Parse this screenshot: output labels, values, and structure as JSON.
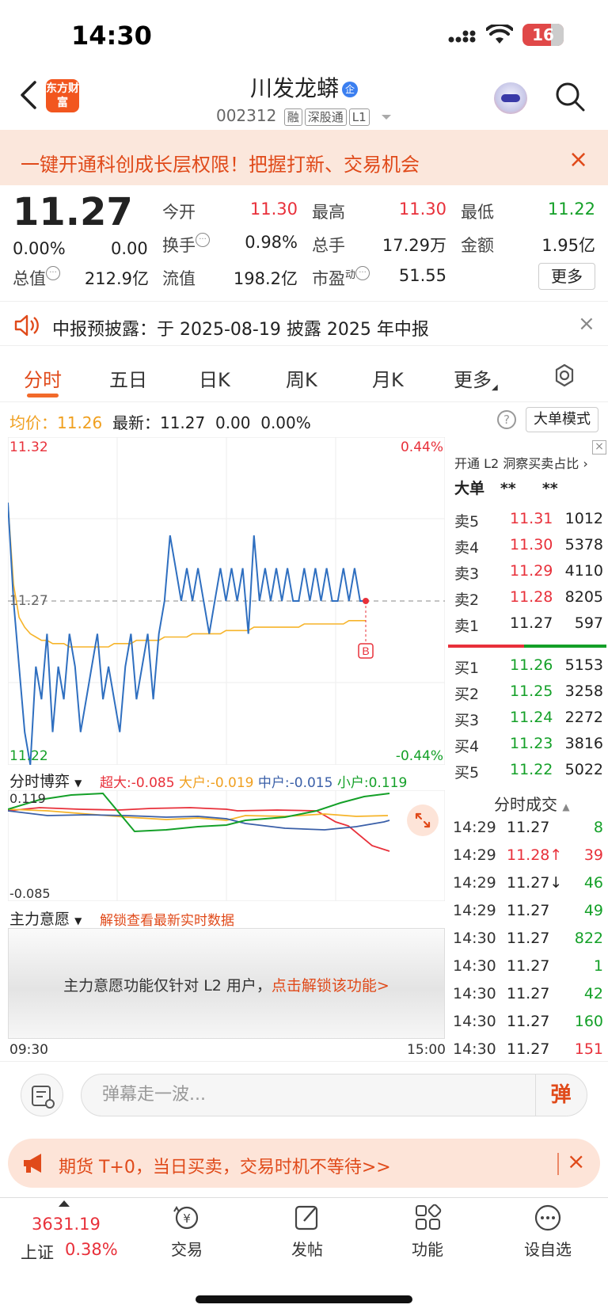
{
  "status": {
    "time": "14:30",
    "battery": "16"
  },
  "header": {
    "logo": "东方财富",
    "stock_name": "川发龙蟒",
    "badge": "企",
    "code": "002312",
    "tags": [
      "融",
      "深股通",
      "L1"
    ]
  },
  "promo": {
    "text": "一键开通科创成长层权限！把握打新、交易机会",
    "close": "×"
  },
  "quote": {
    "price": "11.27",
    "pct": "0.00%",
    "change": "0.00",
    "fields": [
      {
        "label": "今开",
        "value": "11.30"
      },
      {
        "label": "最高",
        "value": "11.30"
      },
      {
        "label": "最低",
        "value": "11.22"
      },
      {
        "label": "换手",
        "value": "0.98%"
      },
      {
        "label": "总手",
        "value": "17.29万"
      },
      {
        "label": "金额",
        "value": "1.95亿"
      },
      {
        "label": "总值",
        "value": "212.9亿"
      },
      {
        "label": "流值",
        "value": "198.2亿"
      },
      {
        "label": "市盈",
        "value": "51.55"
      }
    ],
    "pe_sup": "动",
    "more": "更多"
  },
  "notice": {
    "text": "中报预披露：于 2025-08-19 披露 2025 年中报",
    "close": "×"
  },
  "tabs": [
    "分时",
    "五日",
    "日K",
    "周K",
    "月K",
    "更多"
  ],
  "line_info": {
    "avg_label": "均价：",
    "avg_value": "11.26",
    "latest_label": "最新：",
    "latest_value": "11.27",
    "change": "0.00",
    "pct": "0.00%"
  },
  "help": "?",
  "big_order_mode": "大单模式",
  "chart_data": {
    "type": "line",
    "y_max_label": "11.32",
    "y_min_label": "11.22",
    "pct_max_label": "0.44%",
    "pct_min_label": "-0.44%",
    "ref_label": "11.27",
    "ylim": [
      11.22,
      11.32
    ],
    "prev_close": 11.27,
    "x_start": "09:30",
    "x_end": "15:00",
    "buy_marker": "B",
    "series": [
      {
        "values": [
          11.3,
          11.27,
          11.25,
          11.23,
          11.22,
          11.25,
          11.24,
          11.26,
          11.23,
          11.25,
          11.24,
          11.26,
          11.25,
          11.23,
          11.24,
          11.25,
          11.26,
          11.24,
          11.25,
          11.24,
          11.23,
          11.25,
          11.26,
          11.24,
          11.25,
          11.26,
          11.24,
          11.26,
          11.27,
          11.29,
          11.28,
          11.27,
          11.28,
          11.27,
          11.28,
          11.27,
          11.26,
          11.27,
          11.28,
          11.27,
          11.28,
          11.27,
          11.28,
          11.26,
          11.29,
          11.27,
          11.28,
          11.27,
          11.28,
          11.27,
          11.28,
          11.27,
          11.27,
          11.28,
          11.27,
          11.28,
          11.27,
          11.28,
          11.27,
          11.27,
          11.28,
          11.27,
          11.28,
          11.27,
          11.27
        ]
      },
      {
        "values": [
          11.3,
          11.275,
          11.265,
          11.262,
          11.26,
          11.259,
          11.258,
          11.258,
          11.257,
          11.257,
          11.257,
          11.256,
          11.256,
          11.256,
          11.256,
          11.256,
          11.256,
          11.256,
          11.256,
          11.257,
          11.257,
          11.257,
          11.257,
          11.258,
          11.258,
          11.258,
          11.258,
          11.258,
          11.259,
          11.259,
          11.259,
          11.259,
          11.259,
          11.26,
          11.26,
          11.26,
          11.26,
          11.26,
          11.26,
          11.261,
          11.261,
          11.261,
          11.261,
          11.261,
          11.262,
          11.262,
          11.262,
          11.262,
          11.262,
          11.262,
          11.262,
          11.262,
          11.262,
          11.263,
          11.263,
          11.263,
          11.263,
          11.263,
          11.263,
          11.263,
          11.263,
          11.264,
          11.264,
          11.264,
          11.264
        ]
      }
    ]
  },
  "order_book": {
    "header": "开通 L2 洞察买卖占比",
    "close": "×",
    "big_label": "大单",
    "big_vals": [
      "**",
      "**"
    ],
    "sells": [
      {
        "label": "卖5",
        "price": "11.31",
        "vol": "1012"
      },
      {
        "label": "卖4",
        "price": "11.30",
        "vol": "5378"
      },
      {
        "label": "卖3",
        "price": "11.29",
        "vol": "4110"
      },
      {
        "label": "卖2",
        "price": "11.28",
        "vol": "8205"
      },
      {
        "label": "卖1",
        "price": "11.27",
        "vol": "597"
      }
    ],
    "buys": [
      {
        "label": "买1",
        "price": "11.26",
        "vol": "5153"
      },
      {
        "label": "买2",
        "price": "11.25",
        "vol": "3258"
      },
      {
        "label": "买3",
        "price": "11.24",
        "vol": "2272"
      },
      {
        "label": "买4",
        "price": "11.23",
        "vol": "3816"
      },
      {
        "label": "买5",
        "price": "11.22",
        "vol": "5022"
      }
    ]
  },
  "game": {
    "label": "分时博弈",
    "legend": [
      {
        "name": "超大",
        "value": "-0.085",
        "color": "#e8303a"
      },
      {
        "name": "大户",
        "value": "-0.019",
        "color": "#f0a020"
      },
      {
        "name": "中户",
        "value": "-0.015",
        "color": "#3a5fa8"
      },
      {
        "name": "小户",
        "value": "0.119",
        "color": "#14a028"
      }
    ],
    "y_max": "0.119",
    "y_min": "-0.085"
  },
  "will": {
    "label": "主力意愿",
    "link": "解锁查看最新实时数据",
    "lock_text": "主力意愿功能仅针对 L2 用户，",
    "lock_link": "点击解锁该功能>"
  },
  "ticks": {
    "title": "分时成交",
    "rows": [
      {
        "time": "14:29",
        "price": "11.27",
        "vol": "8",
        "pc": "#222",
        "vc": "#14a028"
      },
      {
        "time": "14:29",
        "price": "11.28↑",
        "vol": "39",
        "pc": "#e8303a",
        "vc": "#e8303a"
      },
      {
        "time": "14:29",
        "price": "11.27↓",
        "vol": "46",
        "pc": "#222",
        "vc": "#14a028"
      },
      {
        "time": "14:29",
        "price": "11.27",
        "vol": "49",
        "pc": "#222",
        "vc": "#14a028"
      },
      {
        "time": "14:30",
        "price": "11.27",
        "vol": "822",
        "pc": "#222",
        "vc": "#14a028"
      },
      {
        "time": "14:30",
        "price": "11.27",
        "vol": "1",
        "pc": "#222",
        "vc": "#14a028"
      },
      {
        "time": "14:30",
        "price": "11.27",
        "vol": "42",
        "pc": "#222",
        "vc": "#14a028"
      },
      {
        "time": "14:30",
        "price": "11.27",
        "vol": "160",
        "pc": "#222",
        "vc": "#14a028"
      },
      {
        "time": "14:30",
        "price": "11.27",
        "vol": "151",
        "pc": "#222",
        "vc": "#e8303a"
      }
    ]
  },
  "comment": {
    "placeholder": "弹幕走一波...",
    "send": "弹"
  },
  "futures": {
    "text": "期货 T+0，当日买卖，交易时机不等待>>",
    "close": "×"
  },
  "bottom_nav": {
    "index_value": "3631.19",
    "index_name": "上证",
    "index_pct": "0.38%",
    "items": [
      "交易",
      "发帖",
      "功能",
      "设自选"
    ]
  }
}
